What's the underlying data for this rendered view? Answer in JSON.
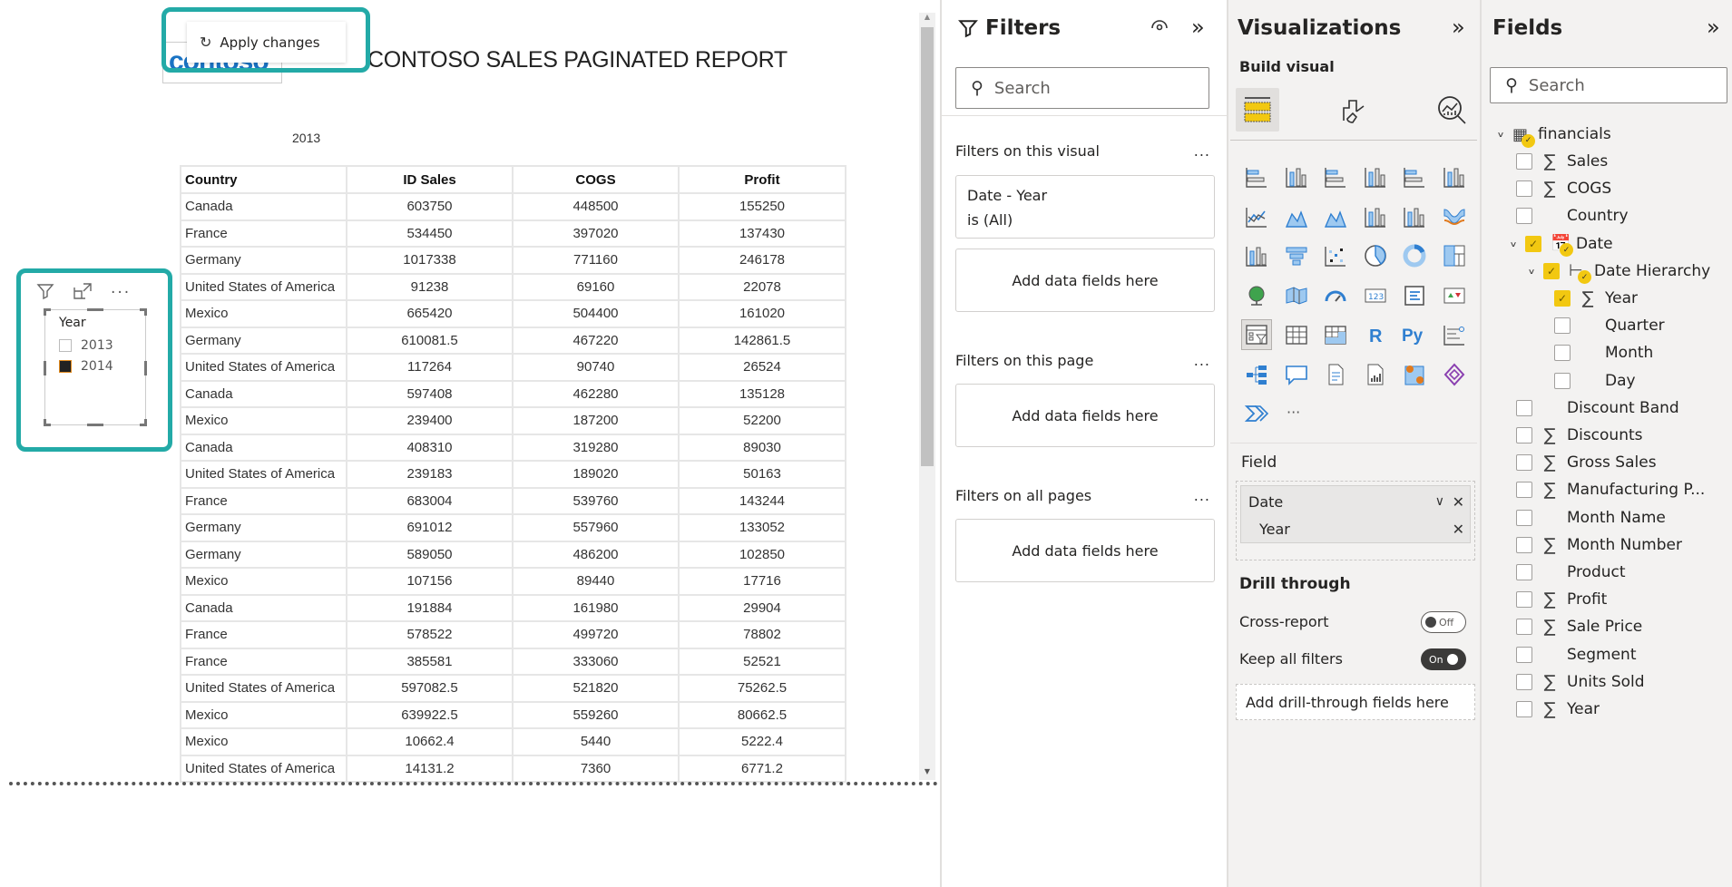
{
  "report": {
    "apply_changes_label": "Apply changes",
    "logo_text": "contoso",
    "title": "CONTOSO SALES PAGINATED REPORT",
    "year_label": "2013",
    "table": {
      "columns": [
        "Country",
        "ID Sales",
        "COGS",
        "Profit"
      ],
      "rows": [
        [
          "Canada",
          "603750",
          "448500",
          "155250"
        ],
        [
          "France",
          "534450",
          "397020",
          "137430"
        ],
        [
          "Germany",
          "1017338",
          "771160",
          "246178"
        ],
        [
          "United States of America",
          "91238",
          "69160",
          "22078"
        ],
        [
          "Mexico",
          "665420",
          "504400",
          "161020"
        ],
        [
          "Germany",
          "610081.5",
          "467220",
          "142861.5"
        ],
        [
          "United States of America",
          "117264",
          "90740",
          "26524"
        ],
        [
          "Canada",
          "597408",
          "462280",
          "135128"
        ],
        [
          "Mexico",
          "239400",
          "187200",
          "52200"
        ],
        [
          "Canada",
          "408310",
          "319280",
          "89030"
        ],
        [
          "United States of America",
          "239183",
          "189020",
          "50163"
        ],
        [
          "France",
          "683004",
          "539760",
          "143244"
        ],
        [
          "Germany",
          "691012",
          "557960",
          "133052"
        ],
        [
          "Germany",
          "589050",
          "486200",
          "102850"
        ],
        [
          "Mexico",
          "107156",
          "89440",
          "17716"
        ],
        [
          "Canada",
          "191884",
          "161980",
          "29904"
        ],
        [
          "France",
          "578522",
          "499720",
          "78802"
        ],
        [
          "France",
          "385581",
          "333060",
          "52521"
        ],
        [
          "United States of America",
          "597082.5",
          "521820",
          "75262.5"
        ],
        [
          "Mexico",
          "639922.5",
          "559260",
          "80662.5"
        ],
        [
          "Mexico",
          "10662.4",
          "5440",
          "5222.4"
        ],
        [
          "United States of America",
          "14131.2",
          "7360",
          "6771.2"
        ]
      ]
    }
  },
  "slicer": {
    "title": "Year",
    "options": [
      {
        "label": "2013",
        "checked": false
      },
      {
        "label": "2014",
        "checked": true
      }
    ],
    "toolbar_icons": [
      "filter-icon",
      "focus-mode-icon",
      "more-options-icon"
    ]
  },
  "filters": {
    "title": "Filters",
    "search_placeholder": "Search",
    "sections": {
      "visual": {
        "title": "Filters on this visual",
        "more": "...",
        "card_line1": "Date - Year",
        "card_line2": "is (All)",
        "add": "Add data fields here"
      },
      "page": {
        "title": "Filters on this page",
        "more": "...",
        "add": "Add data fields here"
      },
      "all": {
        "title": "Filters on all pages",
        "more": "...",
        "add": "Add data fields here"
      }
    }
  },
  "visualizations": {
    "title": "Visualizations",
    "subtitle": "Build visual",
    "tabs": [
      "build-visual",
      "format-visual",
      "analytics"
    ],
    "more_visuals": "...",
    "field_label": "Field",
    "field_well": {
      "group": "Date",
      "item": "Year"
    },
    "drill_through": {
      "title": "Drill through",
      "cross_report": {
        "label": "Cross-report",
        "state": "Off"
      },
      "keep_filters": {
        "label": "Keep all filters",
        "state": "On"
      },
      "add": "Add drill-through fields here"
    },
    "colors": {
      "accent_blue": "#118dff",
      "yellow": "#f2c811"
    }
  },
  "fields": {
    "title": "Fields",
    "search_placeholder": "Search",
    "table_name": "financials",
    "items": [
      {
        "label": "Sales",
        "sigma": true,
        "checked": false,
        "level": 1
      },
      {
        "label": "COGS",
        "sigma": true,
        "checked": false,
        "level": 1
      },
      {
        "label": "Country",
        "sigma": false,
        "checked": false,
        "level": 1
      },
      {
        "label": "Date",
        "sigma": false,
        "checked": true,
        "level": 1,
        "type": "date"
      },
      {
        "label": "Date Hierarchy",
        "sigma": false,
        "checked": true,
        "level": 2,
        "type": "hierarchy"
      },
      {
        "label": "Year",
        "sigma": true,
        "checked": true,
        "level": 3
      },
      {
        "label": "Quarter",
        "sigma": false,
        "checked": false,
        "level": 3
      },
      {
        "label": "Month",
        "sigma": false,
        "checked": false,
        "level": 3
      },
      {
        "label": "Day",
        "sigma": false,
        "checked": false,
        "level": 3
      },
      {
        "label": "Discount Band",
        "sigma": false,
        "checked": false,
        "level": 1
      },
      {
        "label": "Discounts",
        "sigma": true,
        "checked": false,
        "level": 1
      },
      {
        "label": "Gross Sales",
        "sigma": true,
        "checked": false,
        "level": 1
      },
      {
        "label": "Manufacturing P...",
        "sigma": true,
        "checked": false,
        "level": 1
      },
      {
        "label": "Month Name",
        "sigma": false,
        "checked": false,
        "level": 1
      },
      {
        "label": "Month Number",
        "sigma": true,
        "checked": false,
        "level": 1
      },
      {
        "label": "Product",
        "sigma": false,
        "checked": false,
        "level": 1
      },
      {
        "label": "Profit",
        "sigma": true,
        "checked": false,
        "level": 1
      },
      {
        "label": "Sale Price",
        "sigma": true,
        "checked": false,
        "level": 1
      },
      {
        "label": "Segment",
        "sigma": false,
        "checked": false,
        "level": 1
      },
      {
        "label": "Units Sold",
        "sigma": true,
        "checked": false,
        "level": 1
      },
      {
        "label": "Year",
        "sigma": true,
        "checked": false,
        "level": 1
      }
    ]
  }
}
